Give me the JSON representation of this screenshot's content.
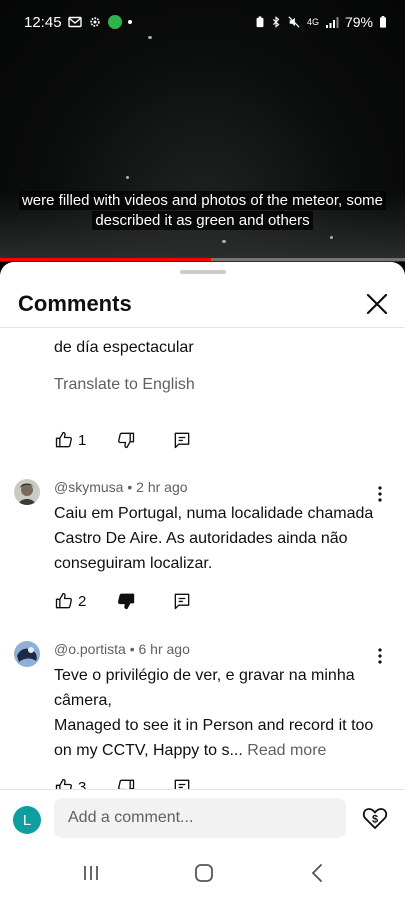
{
  "status_bar": {
    "time": "12:45",
    "battery": "79%",
    "network": "4G"
  },
  "video": {
    "caption": "were filled with videos and photos of the meteor, some described it as green and others",
    "progress_fraction": 0.52,
    "accent_color": "#ff0000"
  },
  "comments_panel": {
    "title": "Comments",
    "first_comment": {
      "text_tail": "de día espectacular",
      "translate_label": "Translate to English",
      "likes": "1"
    },
    "comments": [
      {
        "author": "@skymusa",
        "time": "2 hr ago",
        "text": "Caiu em Portugal, numa localidade chamada Castro De Aire. As autoridades ainda não conseguiram localizar.",
        "likes": "2"
      },
      {
        "author": "@o.portista",
        "time": "6 hr ago",
        "text_line1": "Teve o privilégio de ver, e gravar na minha câmera,",
        "text_line2": "Managed to see it in Person and record it too on my CCTV, Happy to s...",
        "read_more": "Read more",
        "likes": "3"
      }
    ]
  },
  "add_comment": {
    "avatar_letter": "L",
    "placeholder": "Add a comment...",
    "avatar_color": "#0f9d9f"
  },
  "icons": {
    "status": [
      "mail-icon",
      "settings-icon",
      "sync-app-icon",
      "battery-saver-icon",
      "bluetooth-icon",
      "mute-icon",
      "signal-icon",
      "battery-icon"
    ],
    "comment_actions": [
      "thumb-up-icon",
      "thumb-down-icon",
      "reply-icon",
      "more-icon"
    ],
    "nav": [
      "recents-icon",
      "home-icon",
      "back-icon"
    ]
  }
}
